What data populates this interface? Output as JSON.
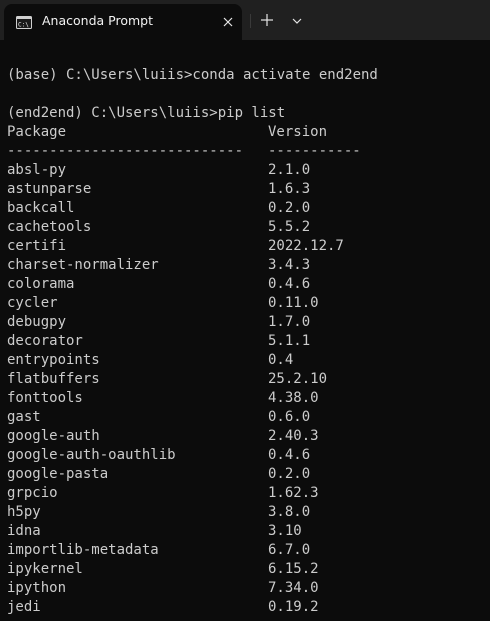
{
  "window": {
    "tab_title": "Anaconda Prompt",
    "tab_icon": "terminal-icon",
    "close_icon": "close-icon",
    "new_tab_icon": "plus-icon",
    "dropdown_icon": "chevron-down-icon"
  },
  "terminal": {
    "command1": "(base) C:\\Users\\luiis>conda activate end2end",
    "command2": "(end2end) C:\\Users\\luiis>pip list",
    "header_package": "Package",
    "header_version": "Version",
    "sep_package": "----------------------------",
    "sep_version": "-----------",
    "packages": [
      {
        "name": "absl-py",
        "version": "2.1.0"
      },
      {
        "name": "astunparse",
        "version": "1.6.3"
      },
      {
        "name": "backcall",
        "version": "0.2.0"
      },
      {
        "name": "cachetools",
        "version": "5.5.2"
      },
      {
        "name": "certifi",
        "version": "2022.12.7"
      },
      {
        "name": "charset-normalizer",
        "version": "3.4.3"
      },
      {
        "name": "colorama",
        "version": "0.4.6"
      },
      {
        "name": "cycler",
        "version": "0.11.0"
      },
      {
        "name": "debugpy",
        "version": "1.7.0"
      },
      {
        "name": "decorator",
        "version": "5.1.1"
      },
      {
        "name": "entrypoints",
        "version": "0.4"
      },
      {
        "name": "flatbuffers",
        "version": "25.2.10"
      },
      {
        "name": "fonttools",
        "version": "4.38.0"
      },
      {
        "name": "gast",
        "version": "0.6.0"
      },
      {
        "name": "google-auth",
        "version": "2.40.3"
      },
      {
        "name": "google-auth-oauthlib",
        "version": "0.4.6"
      },
      {
        "name": "google-pasta",
        "version": "0.2.0"
      },
      {
        "name": "grpcio",
        "version": "1.62.3"
      },
      {
        "name": "h5py",
        "version": "3.8.0"
      },
      {
        "name": "idna",
        "version": "3.10"
      },
      {
        "name": "importlib-metadata",
        "version": "6.7.0"
      },
      {
        "name": "ipykernel",
        "version": "6.15.2"
      },
      {
        "name": "ipython",
        "version": "7.34.0"
      },
      {
        "name": "jedi",
        "version": "0.19.2"
      }
    ]
  }
}
